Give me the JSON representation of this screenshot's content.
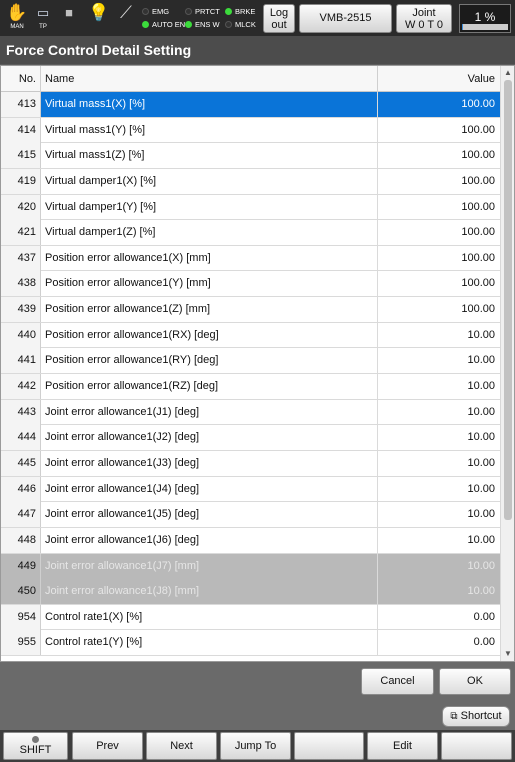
{
  "status_bar": {
    "icons": [
      {
        "name": "hand-icon",
        "label": "MAN"
      },
      {
        "name": "teach-pendant-icon",
        "label": "TP"
      },
      {
        "name": "stop-icon",
        "label": ""
      },
      {
        "name": "lightbulb-icon",
        "label": ""
      },
      {
        "name": "wrench-icon",
        "label": ""
      }
    ],
    "indicators": [
      {
        "label": "EMG",
        "on": false
      },
      {
        "label": "AUTO EN",
        "on": true
      },
      {
        "label": "PRTCT",
        "on": false
      },
      {
        "label": "ENS W",
        "on": true
      },
      {
        "label": "BRKE",
        "on": true
      },
      {
        "label": "MLCK",
        "on": false
      }
    ],
    "logout_line1": "Log",
    "logout_line2": "out",
    "robot_model": "VMB-2515",
    "joint_line1": "Joint",
    "joint_line2": "W 0 T 0",
    "speed_label": "1 %",
    "speed_fraction": 0.01
  },
  "title": "Force Control Detail Setting",
  "table": {
    "headers": {
      "no": "No.",
      "name": "Name",
      "value": "Value"
    },
    "rows": [
      {
        "no": "413",
        "name": "Virtual mass1(X) [%]",
        "value": "100.00",
        "state": "selected"
      },
      {
        "no": "414",
        "name": "Virtual mass1(Y) [%]",
        "value": "100.00",
        "state": "normal"
      },
      {
        "no": "415",
        "name": "Virtual mass1(Z) [%]",
        "value": "100.00",
        "state": "normal"
      },
      {
        "no": "419",
        "name": "Virtual damper1(X) [%]",
        "value": "100.00",
        "state": "normal"
      },
      {
        "no": "420",
        "name": "Virtual damper1(Y) [%]",
        "value": "100.00",
        "state": "normal"
      },
      {
        "no": "421",
        "name": "Virtual damper1(Z) [%]",
        "value": "100.00",
        "state": "normal"
      },
      {
        "no": "437",
        "name": "Position error allowance1(X) [mm]",
        "value": "100.00",
        "state": "normal"
      },
      {
        "no": "438",
        "name": "Position error allowance1(Y) [mm]",
        "value": "100.00",
        "state": "normal"
      },
      {
        "no": "439",
        "name": "Position error allowance1(Z) [mm]",
        "value": "100.00",
        "state": "normal"
      },
      {
        "no": "440",
        "name": "Position error allowance1(RX) [deg]",
        "value": "10.00",
        "state": "normal"
      },
      {
        "no": "441",
        "name": "Position error allowance1(RY) [deg]",
        "value": "10.00",
        "state": "normal"
      },
      {
        "no": "442",
        "name": "Position error allowance1(RZ) [deg]",
        "value": "10.00",
        "state": "normal"
      },
      {
        "no": "443",
        "name": "Joint error allowance1(J1) [deg]",
        "value": "10.00",
        "state": "normal"
      },
      {
        "no": "444",
        "name": "Joint error allowance1(J2) [deg]",
        "value": "10.00",
        "state": "normal"
      },
      {
        "no": "445",
        "name": "Joint error allowance1(J3) [deg]",
        "value": "10.00",
        "state": "normal"
      },
      {
        "no": "446",
        "name": "Joint error allowance1(J4) [deg]",
        "value": "10.00",
        "state": "normal"
      },
      {
        "no": "447",
        "name": "Joint error allowance1(J5) [deg]",
        "value": "10.00",
        "state": "normal"
      },
      {
        "no": "448",
        "name": "Joint error allowance1(J6) [deg]",
        "value": "10.00",
        "state": "normal"
      },
      {
        "no": "449",
        "name": "Joint error allowance1(J7) [mm]",
        "value": "10.00",
        "state": "disabled"
      },
      {
        "no": "450",
        "name": "Joint error allowance1(J8) [mm]",
        "value": "10.00",
        "state": "disabled"
      },
      {
        "no": "954",
        "name": "Control rate1(X) [%]",
        "value": "0.00",
        "state": "normal"
      },
      {
        "no": "955",
        "name": "Control rate1(Y) [%]",
        "value": "0.00",
        "state": "normal"
      }
    ]
  },
  "actions": {
    "cancel": "Cancel",
    "ok": "OK",
    "shortcut": "Shortcut"
  },
  "function_keys": [
    "SHIFT",
    "Prev",
    "Next",
    "Jump To",
    "",
    "Edit",
    ""
  ]
}
